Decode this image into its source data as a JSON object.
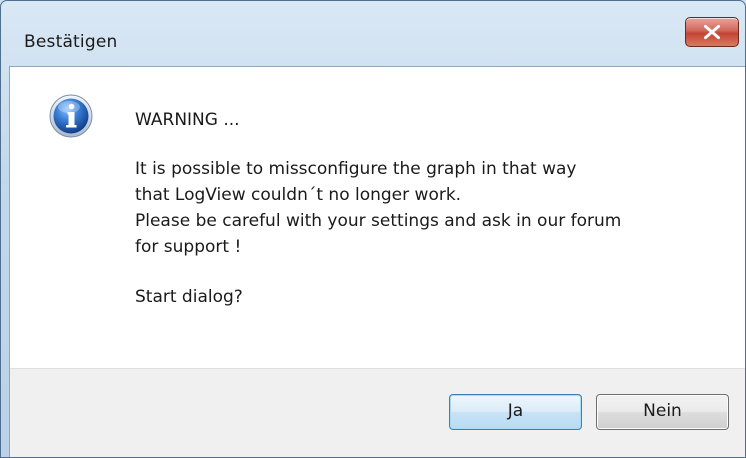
{
  "dialog": {
    "title": "Bestätigen",
    "close_glyph": "X",
    "icon": "info-icon",
    "message": {
      "heading": "WARNING ...",
      "lines": [
        "It is possible to missconfigure the graph in that way",
        "that LogView couldn´t no longer work.",
        "Please be careful with your settings and ask in our forum",
        "for support !"
      ],
      "question": "Start dialog?"
    },
    "buttons": {
      "yes_label": "Ja",
      "no_label": "Nein"
    }
  },
  "colors": {
    "title_bar": "#c3d7ea",
    "close_button": "#c24534",
    "button_area": "#f0f0f0",
    "default_button_border": "#3c7fb1",
    "info_icon_blue": "#1f5fb5"
  }
}
